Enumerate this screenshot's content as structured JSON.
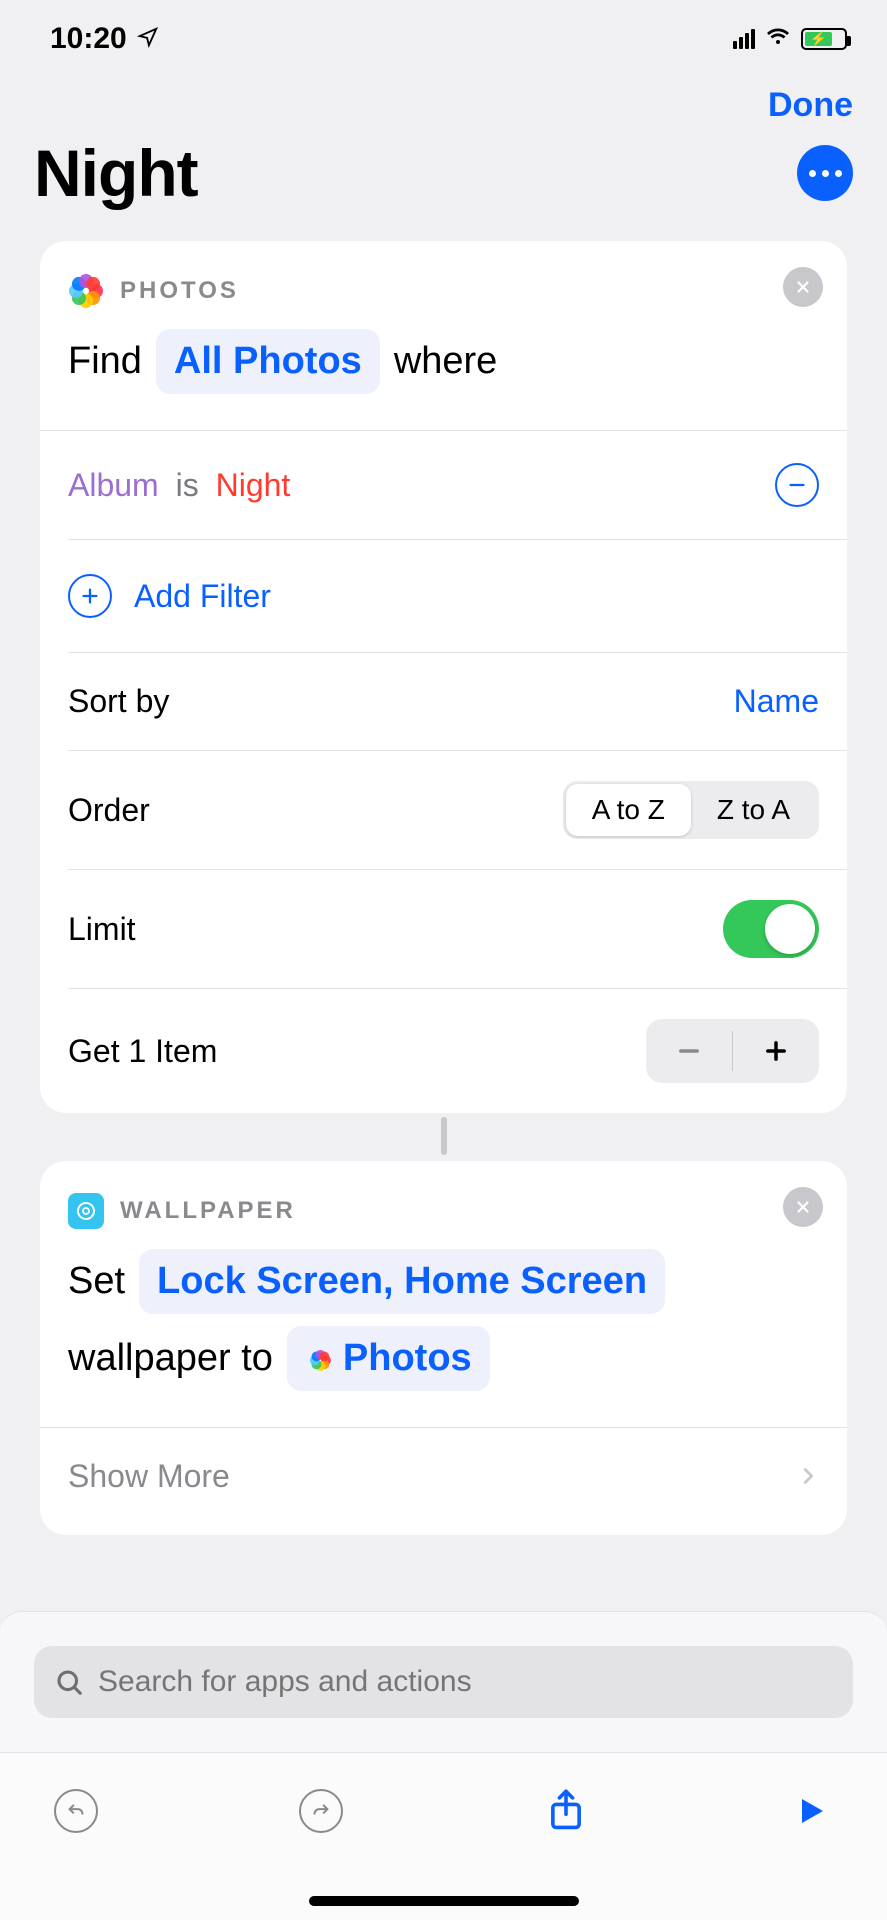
{
  "status": {
    "time": "10:20"
  },
  "nav": {
    "done": "Done"
  },
  "title": "Night",
  "actions": [
    {
      "app": "PHOTOS",
      "find": {
        "verb": "Find",
        "target": "All Photos",
        "suffix": "where"
      },
      "filter": {
        "field": "Album",
        "op": "is",
        "value": "Night"
      },
      "addFilter": "Add Filter",
      "sort": {
        "label": "Sort by",
        "value": "Name"
      },
      "order": {
        "label": "Order",
        "opt1": "A to Z",
        "opt2": "Z to A"
      },
      "limit": {
        "label": "Limit"
      },
      "get": {
        "label": "Get 1 Item"
      }
    },
    {
      "app": "WALLPAPER",
      "set": {
        "verb": "Set",
        "targets": "Lock Screen, Home Screen",
        "mid": "wallpaper to",
        "source": "Photos"
      },
      "showMore": "Show More"
    }
  ],
  "search": {
    "placeholder": "Search for apps and actions"
  }
}
